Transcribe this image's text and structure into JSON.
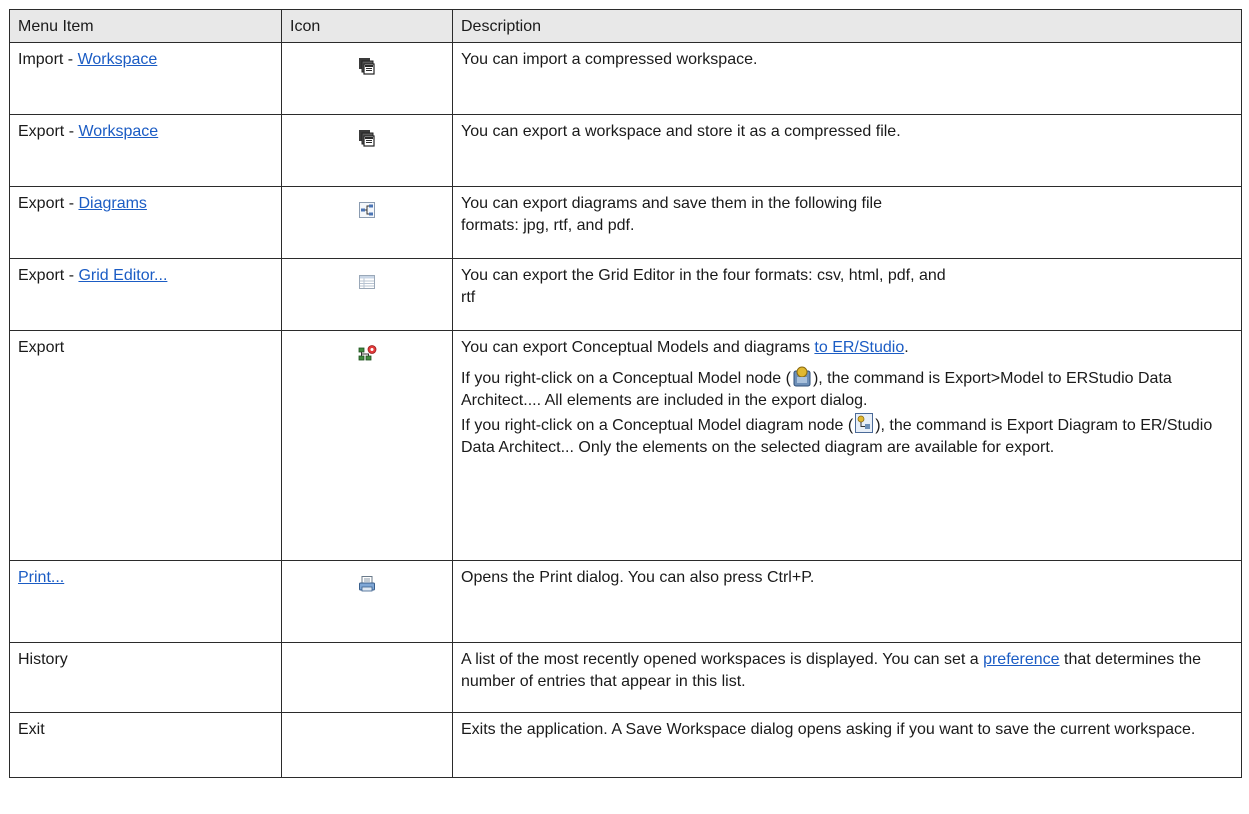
{
  "headers": [
    "Menu Item",
    "Icon",
    "Description"
  ],
  "rows": [
    {
      "item_prefix": "Import - ",
      "item_link": "Workspace",
      "icon": "workspace-icon",
      "desc": "You can import a compressed workspace."
    },
    {
      "item_prefix": "Export - ",
      "item_link": "Workspace",
      "icon": "workspace-icon",
      "desc": "You can export a workspace and store it as a compressed file."
    },
    {
      "item_prefix": "Export - ",
      "item_link": "Diagrams",
      "icon": "diagram-icon",
      "desc_line1": "You can export diagrams and save them in the following file",
      "desc_line2": "formats: jpg, rtf, and pdf."
    },
    {
      "item_prefix": "Export - ",
      "item_link": "Grid Editor...",
      "icon": "grid-icon",
      "desc_line1": "You can export the Grid Editor in the four formats: csv, html, pdf, and",
      "desc_line2": "rtf"
    },
    {
      "item": "Export",
      "icon": "export-model-icon",
      "desc_p1_text": "You can export Conceptual Models and diagrams ",
      "desc_p1_link": "to ER/Studio",
      "desc_p1_end": ".",
      "desc_p2_a": "If you right-click on a Conceptual Model node (",
      "desc_p2_b": "), the command is Export>Model to ERStudio Data Architect.... All elements are included in the export dialog.",
      "desc_p3_a": "If you right-click on a Conceptual Model diagram node (",
      "desc_p3_b": "), the command is Export Diagram to ER/Studio Data Architect... Only the elements on the selected diagram are available for export."
    },
    {
      "item_link": "Print...",
      "icon": "print-icon",
      "desc": "Opens the Print dialog. You can also press Ctrl+P."
    },
    {
      "item": "History",
      "desc_text": "A list of the most recently opened workspaces is displayed. You can set a ",
      "desc_link": "preference",
      "desc_end": " that determines the number of entries that appear in this list."
    },
    {
      "item": "Exit",
      "desc": "Exits the application. A Save Workspace dialog opens asking if you want to save the current workspace."
    }
  ],
  "colors": {
    "link": "#1b5cc4",
    "header_bg": "#e8e8e8",
    "border": "#2b2b2b"
  }
}
